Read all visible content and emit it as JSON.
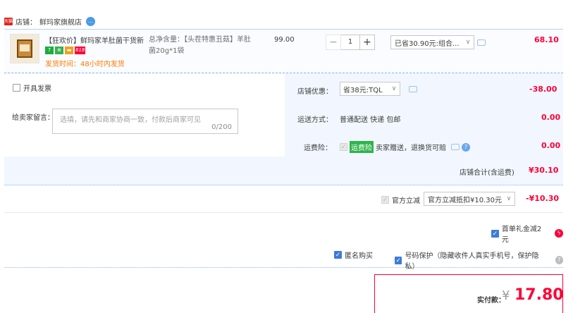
{
  "store": {
    "label": "店铺：",
    "name": "鲜玛家旗舰店",
    "chat_icon": "wangwang-chat-icon"
  },
  "product": {
    "title": "【狂欢价】鲜玛家羊肚菌干货新...",
    "badges": [
      "7",
      "⊕",
      "▬",
      "618"
    ],
    "ship_time": "发货时间：48小时内发货",
    "sku_line1": "总净含量：【头茬特惠丑菇】羊肚",
    "sku_line2": "菌20g*1袋",
    "unit_price": "99.00",
    "quantity": "1",
    "minus": "−",
    "plus": "+",
    "discount_option": "已省30.90元:组合...",
    "subtotal": "68.10"
  },
  "options": {
    "invoice_label": "开具发票",
    "memo_label": "给卖家留言：",
    "memo_placeholder": "选填，请先和商家协商一致，付款后商家可见",
    "memo_count": "0/200",
    "store_discount_label": "店铺优惠：",
    "store_discount_value": "省38元:TQL",
    "store_discount_amount": "-38.00",
    "delivery_label": "运送方式：",
    "delivery_value": "普通配送 快递 包邮",
    "delivery_amount": "0.00",
    "insurance_label": "运费险：",
    "insurance_tag": "运费险",
    "insurance_text": "卖家赠送，退换货可赔",
    "insurance_amount": "0.00",
    "store_total_label": "店铺合计(含运费)",
    "store_total_value": "¥30.10"
  },
  "official": {
    "label": "官方立减",
    "select_value": "官方立减抵扣¥10.30元",
    "amount": "-¥10.30"
  },
  "gift": {
    "label": "首单礼金减2元"
  },
  "privacy": {
    "anonymous_label": "匿名购买",
    "number_protect_label": "号码保护（隐藏收件人真实手机号，保护隐私）"
  },
  "payment": {
    "label": "实付款：",
    "currency": "¥",
    "amount": "17.80"
  },
  "colors": {
    "accent_red": "#ff0036",
    "link_blue": "#3d7bd9",
    "ship_orange": "#ff7a00"
  }
}
